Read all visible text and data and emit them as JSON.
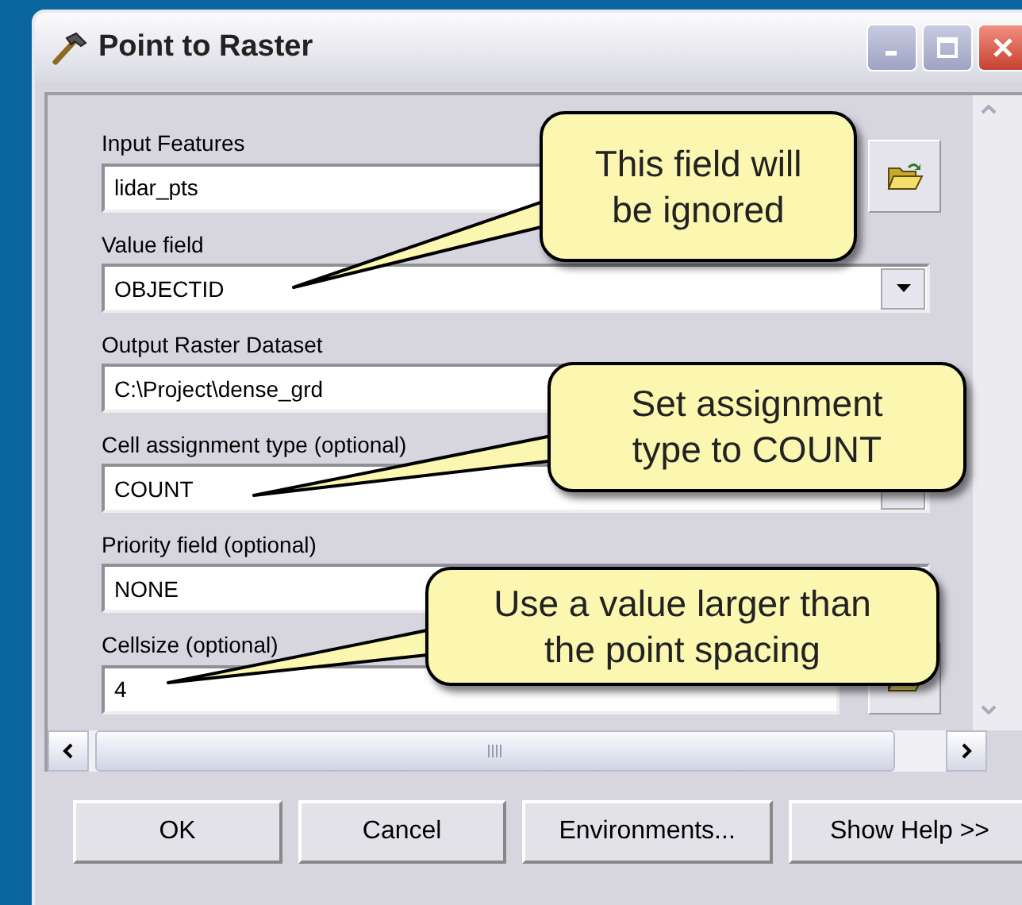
{
  "window": {
    "title": "Point to Raster"
  },
  "fields": [
    {
      "label": "Input Features",
      "value": "lidar_pts",
      "kind": "browse"
    },
    {
      "label": "Value field",
      "value": "OBJECTID",
      "kind": "dropdown"
    },
    {
      "label": "Output Raster Dataset",
      "value": "C:\\Project\\dense_grd",
      "kind": "text"
    },
    {
      "label": "Cell assignment type (optional)",
      "value": "COUNT",
      "kind": "dropdown"
    },
    {
      "label": "Priority field (optional)",
      "value": "NONE",
      "kind": "dropdown"
    },
    {
      "label": "Cellsize (optional)",
      "value": "4",
      "kind": "browse"
    }
  ],
  "callouts": [
    "This field will be ignored",
    "Set assignment type to COUNT",
    "Use a value larger than the point spacing"
  ],
  "buttons": [
    "OK",
    "Cancel",
    "Environments...",
    "Show Help >>"
  ]
}
